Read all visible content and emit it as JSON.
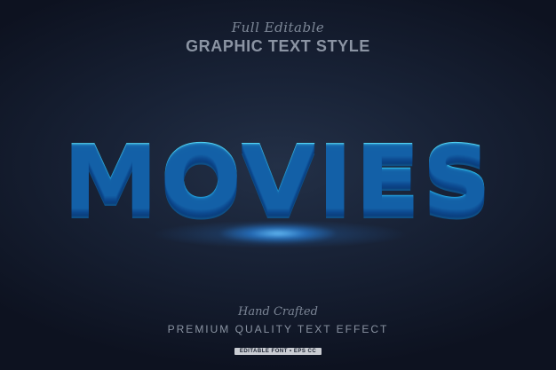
{
  "header": {
    "script_line": "Full Editable",
    "title": "GRAPHIC TEXT STYLE"
  },
  "headline": {
    "text": "MOVIES",
    "colors": {
      "face_top": "#5fdcf7",
      "face_bottom": "#1a86d0",
      "extrusion": "#0e4f86",
      "glow": "#6ec8ff"
    }
  },
  "footer": {
    "script_line": "Hand Crafted",
    "title": "PREMIUM QUALITY TEXT EFFECT",
    "badge": "EDITABLE FONT • EPS CC"
  },
  "theme": {
    "background_center": "#233047",
    "background_edge": "#0d1220"
  }
}
